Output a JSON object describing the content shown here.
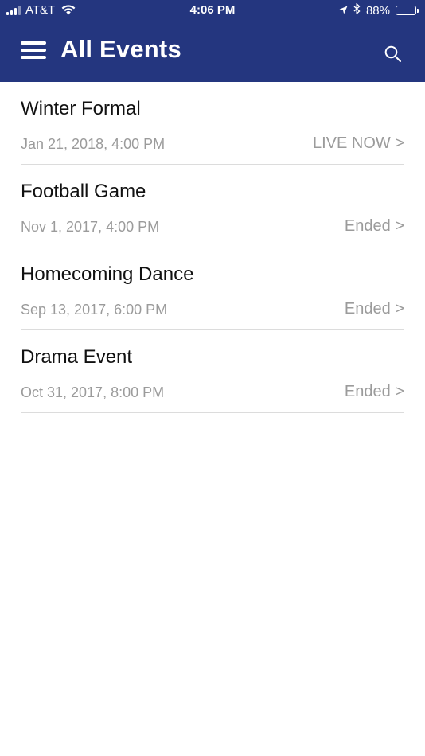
{
  "status_bar": {
    "carrier": "AT&T",
    "time": "4:06 PM",
    "battery_percent": "88%",
    "battery_level": 0.88,
    "icons": [
      "signal-icon",
      "wifi-icon",
      "location-icon",
      "bluetooth-icon",
      "battery-icon"
    ]
  },
  "header": {
    "title": "All Events",
    "menu_icon": "hamburger-menu-icon",
    "search_icon": "search-icon",
    "background_color": "#24367f"
  },
  "events": [
    {
      "name": "Winter Formal",
      "date": "Jan 21, 2018, 4:00 PM",
      "status": "LIVE NOW >"
    },
    {
      "name": "Football Game",
      "date": "Nov 1, 2017, 4:00 PM",
      "status": "Ended >"
    },
    {
      "name": "Homecoming Dance",
      "date": "Sep 13, 2017, 6:00 PM",
      "status": "Ended >"
    },
    {
      "name": "Drama Event",
      "date": "Oct 31, 2017, 8:00 PM",
      "status": "Ended >"
    }
  ]
}
